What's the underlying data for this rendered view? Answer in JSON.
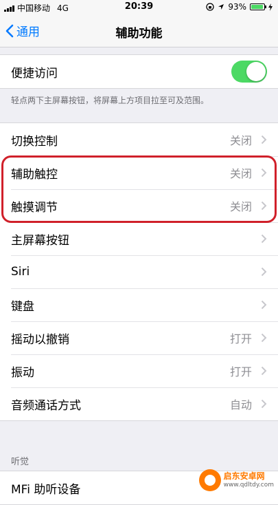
{
  "status_bar": {
    "carrier": "中国移动",
    "network": "4G",
    "time": "20:39",
    "battery": "93%",
    "battery_level": 0.93
  },
  "nav": {
    "back_label": "通用",
    "title": "辅助功能"
  },
  "shortcut": {
    "label": "便捷访问",
    "toggle_on": true,
    "footnote": "轻点两下主屏幕按钮，将屏幕上方项目拉至可及范围。"
  },
  "rows": [
    {
      "label": "切换控制",
      "value": "关闭"
    },
    {
      "label": "辅助触控",
      "value": "关闭"
    },
    {
      "label": "触摸调节",
      "value": "关闭"
    },
    {
      "label": "主屏幕按钮",
      "value": ""
    },
    {
      "label": "Siri",
      "value": ""
    },
    {
      "label": "键盘",
      "value": ""
    },
    {
      "label": "摇动以撤销",
      "value": "打开"
    },
    {
      "label": "振动",
      "value": "打开"
    },
    {
      "label": "音频通话方式",
      "value": "自动"
    }
  ],
  "hearing": {
    "header": "听觉",
    "first_row": "MFi 助听设备"
  },
  "watermark": {
    "name": "启东安卓网",
    "url": "www.qdltdy.com"
  },
  "colors": {
    "accent": "#007aff",
    "toggle_on": "#4cd964",
    "highlight": "#d0202a"
  }
}
